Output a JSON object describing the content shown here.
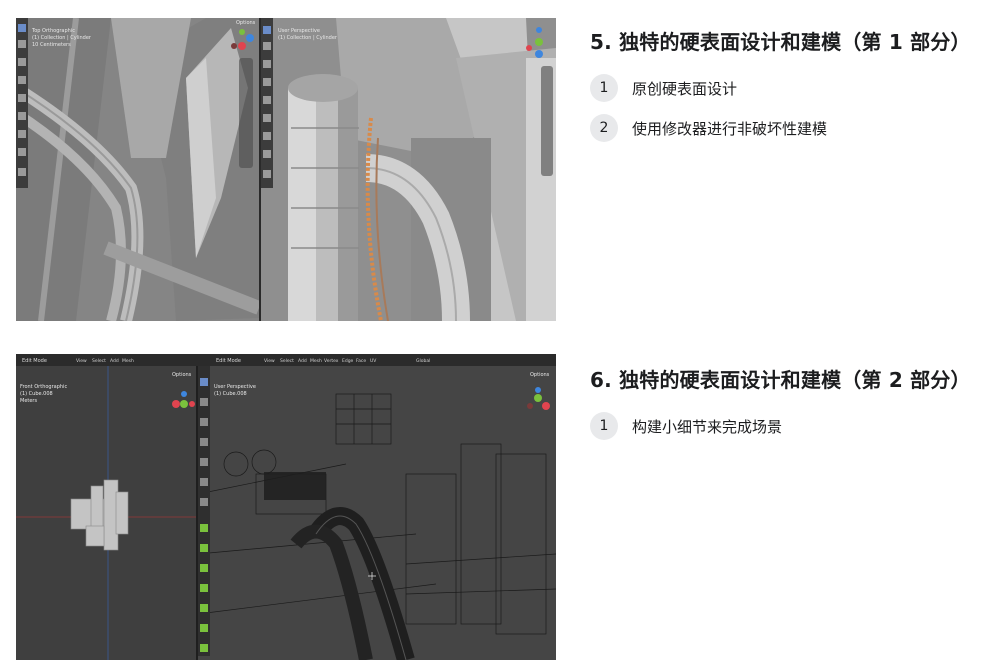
{
  "sections": [
    {
      "title": "5. 独特的硬表面设计和建模（第 1 部分）",
      "items": [
        {
          "number": "1",
          "label": "原创硬表面设计"
        },
        {
          "number": "2",
          "label": "使用修改器进行非破坏性建模"
        }
      ],
      "thumbnail": {
        "left_viewport": {
          "options": "Options",
          "lines": [
            "Top Orthographic",
            "(1) Collection | Cylinder",
            "10 Centimeters"
          ]
        },
        "right_viewport": {
          "lines": [
            "User Perspective",
            "(1) Collection | Cylinder"
          ]
        }
      }
    },
    {
      "title": "6. 独特的硬表面设计和建模（第 2 部分）",
      "items": [
        {
          "number": "1",
          "label": "构建小细节来完成场景"
        }
      ],
      "thumbnail": {
        "left_viewport": {
          "mode": "Edit Mode",
          "menu": [
            "View",
            "Select",
            "Add",
            "Mesh"
          ],
          "options": "Options",
          "lines": [
            "Front Orthographic",
            "(1) Cube.008",
            "Meters"
          ]
        },
        "right_viewport": {
          "mode": "Edit Mode",
          "menu": [
            "View",
            "Select",
            "Add",
            "Mesh",
            "Vertex",
            "Edge",
            "Face",
            "UV"
          ],
          "transform": "Global",
          "options": "Options",
          "lines": [
            "User Perspective",
            "(1) Cube.008"
          ]
        }
      }
    }
  ],
  "colors": {
    "axis_x": "#e0444f",
    "axis_y": "#7ac13d",
    "axis_z": "#3e86de",
    "badge_bg": "#e8e9eb",
    "selection": "#d88a4a"
  }
}
